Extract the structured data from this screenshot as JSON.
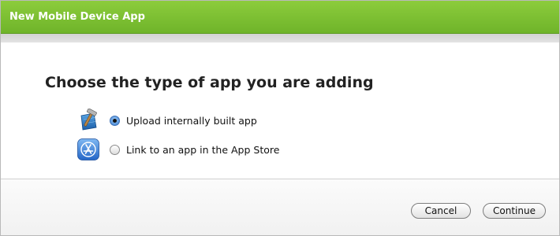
{
  "dialog": {
    "title": "New Mobile Device App"
  },
  "main": {
    "heading": "Choose the type of app you are adding",
    "options": [
      {
        "label": "Upload internally built app",
        "icon": "xcode-hammer-icon",
        "selected": true
      },
      {
        "label": "Link to an app in the App Store",
        "icon": "app-store-icon",
        "selected": false
      }
    ]
  },
  "footer": {
    "cancel_label": "Cancel",
    "continue_label": "Continue"
  }
}
